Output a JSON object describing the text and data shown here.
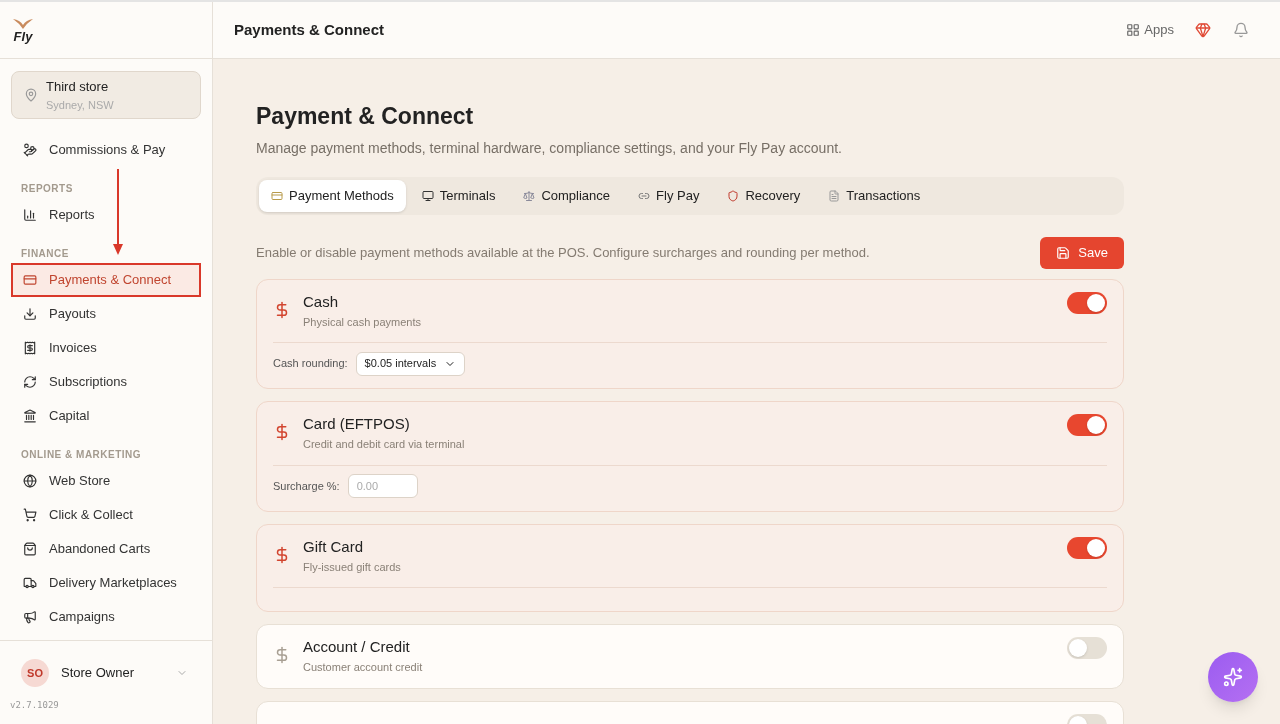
{
  "logo": {
    "text": "Fly"
  },
  "store": {
    "name": "Third store",
    "location": "Sydney, NSW"
  },
  "sidebar": {
    "sections": [
      {
        "items": [
          {
            "label": "Commissions & Pay",
            "selected": false
          }
        ]
      },
      {
        "heading": "REPORTS",
        "items": [
          {
            "label": "Reports",
            "selected": false
          }
        ]
      },
      {
        "heading": "FINANCE",
        "items": [
          {
            "label": "Payments & Connect",
            "selected": true
          },
          {
            "label": "Payouts",
            "selected": false
          },
          {
            "label": "Invoices",
            "selected": false
          },
          {
            "label": "Subscriptions",
            "selected": false
          },
          {
            "label": "Capital",
            "selected": false
          }
        ]
      },
      {
        "heading": "ONLINE & MARKETING",
        "items": [
          {
            "label": "Web Store",
            "selected": false
          },
          {
            "label": "Click & Collect",
            "selected": false
          },
          {
            "label": "Abandoned Carts",
            "selected": false
          },
          {
            "label": "Delivery Marketplaces",
            "selected": false
          },
          {
            "label": "Campaigns",
            "selected": false
          }
        ]
      }
    ]
  },
  "user": {
    "initials": "SO",
    "name": "Store Owner"
  },
  "version": "v2.7.1029",
  "header": {
    "title": "Payments & Connect",
    "apps_label": "Apps"
  },
  "page": {
    "title": "Payment & Connect",
    "subtitle": "Manage payment methods, terminal hardware, compliance settings, and your Fly Pay account."
  },
  "tabs": [
    {
      "label": "Payment Methods",
      "selected": true
    },
    {
      "label": "Terminals",
      "selected": false
    },
    {
      "label": "Compliance",
      "selected": false
    },
    {
      "label": "Fly Pay",
      "selected": false
    },
    {
      "label": "Recovery",
      "selected": false
    },
    {
      "label": "Transactions",
      "selected": false
    }
  ],
  "intro": "Enable or disable payment methods available at the POS. Configure surcharges and rounding per method.",
  "save_label": "Save",
  "methods": [
    {
      "name": "Cash",
      "description": "Physical cash payments",
      "enabled": true,
      "setting": {
        "kind": "select",
        "label": "Cash rounding:",
        "value": "$0.05 intervals"
      }
    },
    {
      "name": "Card (EFTPOS)",
      "description": "Credit and debit card via terminal",
      "enabled": true,
      "setting": {
        "kind": "input",
        "label": "Surcharge %:",
        "placeholder": "0.00"
      }
    },
    {
      "name": "Gift Card",
      "description": "Fly-issued gift cards",
      "enabled": true
    },
    {
      "name": "Account / Credit",
      "description": "Customer account credit",
      "enabled": false
    },
    {
      "enabled": false
    }
  ]
}
